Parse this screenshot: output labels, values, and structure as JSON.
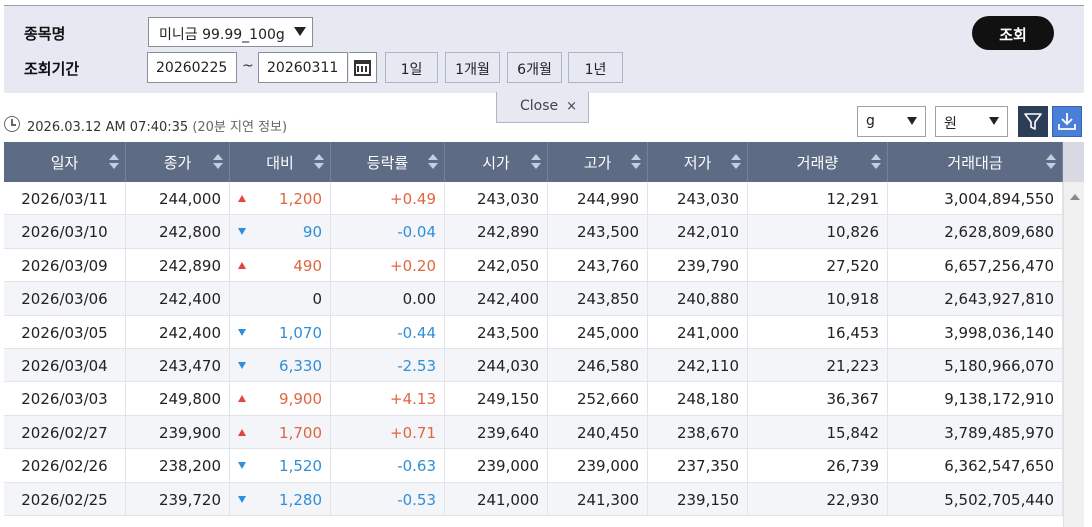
{
  "search": {
    "item_label": "종목명",
    "period_label": "조회기간",
    "product": "미니금 99.99_100g",
    "date_from": "20260225",
    "tilde": "~",
    "date_to": "20260311",
    "ranges": [
      "1일",
      "1개월",
      "6개월",
      "1년"
    ],
    "search_button": "조회",
    "close_label": "Close",
    "close_x": "×"
  },
  "info": {
    "timestamp": "2026.03.12 AM 07:40:35",
    "delay_note": "(20분 지연 정보)",
    "unit_weight": "g",
    "unit_currency": "원"
  },
  "colors": {
    "header_bg": "#5d6b85",
    "up": "#e0663f",
    "down": "#2f8fd8",
    "filter_btn": "#2b3d57",
    "download_btn": "#4a7fd9"
  },
  "icons": {
    "clock": "clock-icon",
    "calendar": "calendar-icon",
    "filter": "filter-icon",
    "download": "download-icon"
  },
  "table": {
    "columns": [
      "일자",
      "종가",
      "대비",
      "등락률",
      "시가",
      "고가",
      "저가",
      "거래량",
      "거래대금"
    ],
    "rows": [
      {
        "date": "2026/03/11",
        "close": "244,000",
        "dir": "up",
        "diff": "1,200",
        "rate": "+0.49",
        "open": "243,030",
        "high": "244,990",
        "low": "243,030",
        "volume": "12,291",
        "value": "3,004,894,550"
      },
      {
        "date": "2026/03/10",
        "close": "242,800",
        "dir": "down",
        "diff": "90",
        "rate": "-0.04",
        "open": "242,890",
        "high": "243,500",
        "low": "242,010",
        "volume": "10,826",
        "value": "2,628,809,680"
      },
      {
        "date": "2026/03/09",
        "close": "242,890",
        "dir": "up",
        "diff": "490",
        "rate": "+0.20",
        "open": "242,050",
        "high": "243,760",
        "low": "239,790",
        "volume": "27,520",
        "value": "6,657,256,470"
      },
      {
        "date": "2026/03/06",
        "close": "242,400",
        "dir": "flat",
        "diff": "0",
        "rate": "0.00",
        "open": "242,400",
        "high": "243,850",
        "low": "240,880",
        "volume": "10,918",
        "value": "2,643,927,810"
      },
      {
        "date": "2026/03/05",
        "close": "242,400",
        "dir": "down",
        "diff": "1,070",
        "rate": "-0.44",
        "open": "243,500",
        "high": "245,000",
        "low": "241,000",
        "volume": "16,453",
        "value": "3,998,036,140"
      },
      {
        "date": "2026/03/04",
        "close": "243,470",
        "dir": "down",
        "diff": "6,330",
        "rate": "-2.53",
        "open": "244,030",
        "high": "246,580",
        "low": "242,110",
        "volume": "21,223",
        "value": "5,180,966,070"
      },
      {
        "date": "2026/03/03",
        "close": "249,800",
        "dir": "up",
        "diff": "9,900",
        "rate": "+4.13",
        "open": "249,150",
        "high": "252,660",
        "low": "248,180",
        "volume": "36,367",
        "value": "9,138,172,910"
      },
      {
        "date": "2026/02/27",
        "close": "239,900",
        "dir": "up",
        "diff": "1,700",
        "rate": "+0.71",
        "open": "239,640",
        "high": "240,450",
        "low": "238,670",
        "volume": "15,842",
        "value": "3,789,485,970"
      },
      {
        "date": "2026/02/26",
        "close": "238,200",
        "dir": "down",
        "diff": "1,520",
        "rate": "-0.63",
        "open": "239,000",
        "high": "239,000",
        "low": "237,350",
        "volume": "26,739",
        "value": "6,362,547,650"
      },
      {
        "date": "2026/02/25",
        "close": "239,720",
        "dir": "down",
        "diff": "1,280",
        "rate": "-0.53",
        "open": "241,000",
        "high": "241,300",
        "low": "239,150",
        "volume": "22,930",
        "value": "5,502,705,440"
      }
    ]
  }
}
